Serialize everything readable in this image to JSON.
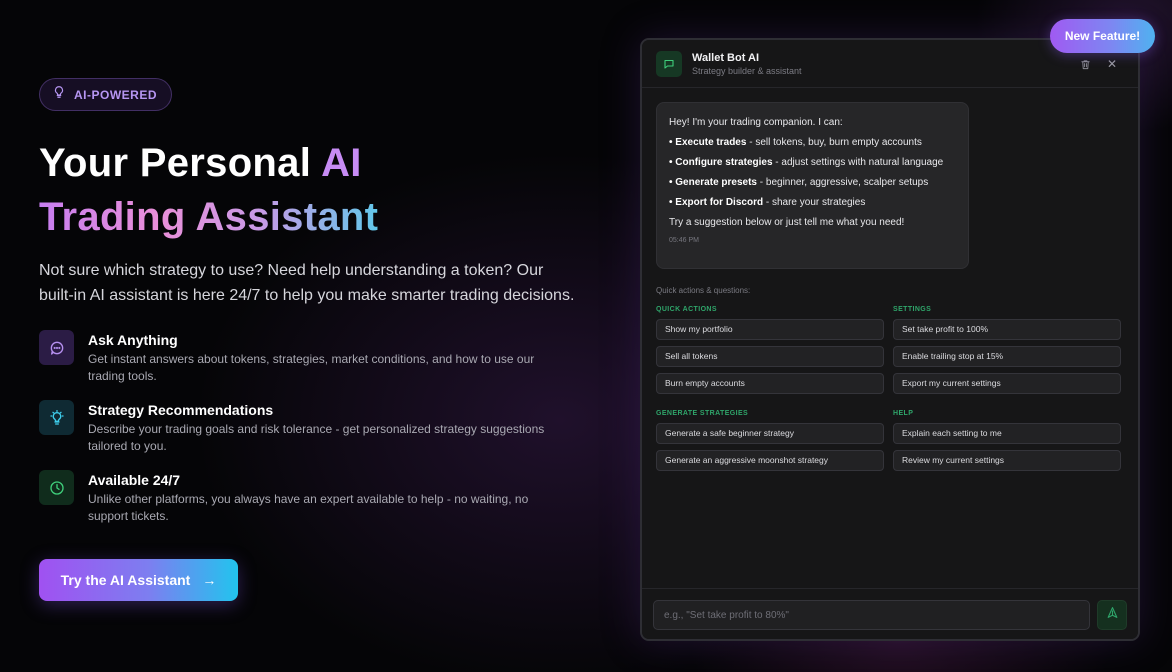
{
  "badge": {
    "label": "AI-POWERED",
    "icon": "lightbulb-icon"
  },
  "headline": {
    "line1_prefix": "Your Personal ",
    "line1_highlight": "AI",
    "line2": "Trading Assistant"
  },
  "lede": "Not sure which strategy to use? Need help understanding a token? Our built-in AI assistant is here 24/7 to help you make smarter trading decisions.",
  "features": [
    {
      "icon": "chat-bubble-icon",
      "title": "Ask Anything",
      "desc": "Get instant answers about tokens, strategies, market conditions, and how to use our trading tools."
    },
    {
      "icon": "lightbulb-icon",
      "title": "Strategy Recommendations",
      "desc": "Describe your trading goals and risk tolerance - get personalized strategy suggestions tailored to you."
    },
    {
      "icon": "clock-icon",
      "title": "Available 24/7",
      "desc": "Unlike other platforms, you always have an expert available to help - no waiting, no support tickets."
    }
  ],
  "cta": {
    "label": "Try the AI Assistant",
    "arrow": "→"
  },
  "new_feature_label": "New Feature!",
  "chat": {
    "bot_name": "Wallet Bot AI",
    "bot_subtitle": "Strategy builder & assistant",
    "close_glyph": "✕",
    "message": {
      "intro": "Hey! I'm your trading companion. I can:",
      "items": [
        {
          "bold": "• Execute trades",
          "rest": " - sell tokens, buy, burn empty accounts"
        },
        {
          "bold": "• Configure strategies",
          "rest": " - adjust settings with natural language"
        },
        {
          "bold": "• Generate presets",
          "rest": " - beginner, aggressive, scalper setups"
        },
        {
          "bold": "• Export for Discord",
          "rest": " - share your strategies"
        }
      ],
      "outro": "Try a suggestion below or just tell me what you need!",
      "timestamp": "05:46 PM"
    },
    "quick_caption": "Quick actions & questions:",
    "sections": {
      "quick_actions": {
        "title": "QUICK ACTIONS",
        "items": [
          "Show my portfolio",
          "Sell all tokens",
          "Burn empty accounts"
        ]
      },
      "settings": {
        "title": "SETTINGS",
        "items": [
          "Set take profit to 100%",
          "Enable trailing stop at 15%",
          "Export my current settings"
        ]
      },
      "generate": {
        "title": "GENERATE STRATEGIES",
        "items": [
          "Generate a safe beginner strategy",
          "Generate an aggressive moonshot strategy"
        ]
      },
      "help": {
        "title": "HELP",
        "items": [
          "Explain each setting to me",
          "Review my current settings"
        ]
      }
    },
    "input_placeholder": "e.g., \"Set take profit to 80%\""
  },
  "colors": {
    "accent_purple": "#a051f1",
    "accent_cyan": "#22c4ee",
    "section_green": "#2fa56a",
    "badge_text": "#b696f2"
  }
}
